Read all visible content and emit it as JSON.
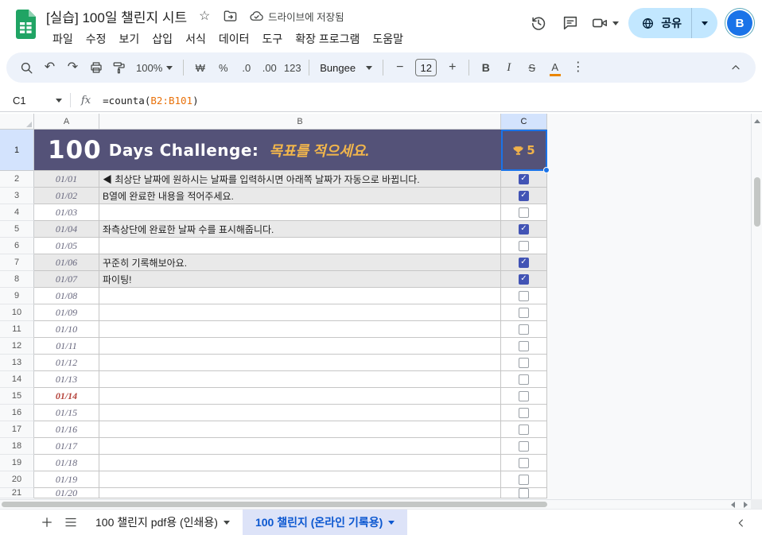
{
  "colors": {
    "banner_bg": "#545278",
    "accent_blue": "#1a73e8",
    "gold": "#f0b24a",
    "checkbox_checked": "#4254b5",
    "share_pill": "#c2e7ff",
    "done_row_bg": "#e9e9e9",
    "today_red": "#b5433b",
    "formula_range_orange": "#e8710a",
    "text_color_swatch": "#ea8600",
    "active_tab_bg": "#dde3f8",
    "active_tab_text": "#0b57d0",
    "selected_header_bg": "#d3e3fd"
  },
  "icons": {
    "undo_icon": "↶",
    "redo_icon": "↷",
    "more_icon": "⋮",
    "star_icon": "☆",
    "checkmark": "✓",
    "minus": "−",
    "plus": "+"
  },
  "titlebar": {
    "doc_title": "[실습] 100일 챌린지 시트",
    "saved_status": "드라이브에 저장됨",
    "share_label": "공유",
    "avatar_initial": "B"
  },
  "menus": [
    "파일",
    "수정",
    "보기",
    "삽입",
    "서식",
    "데이터",
    "도구",
    "확장 프로그램",
    "도움말"
  ],
  "toolbar": {
    "zoom": "100%",
    "currency": "₩",
    "percent": "%",
    "decimal_decrease": ".0",
    "decimal_increase": ".00",
    "number_format": "123",
    "font_name": "Bungee",
    "font_size": "12",
    "bold": "B",
    "italic": "I",
    "strikethrough": "S",
    "text_color": "A"
  },
  "formula_bar": {
    "cell_ref": "C1",
    "fx": "fx",
    "formula_prefix": "=counta(",
    "formula_range": "B2:B101",
    "formula_suffix": ")"
  },
  "grid": {
    "column_headers": [
      "A",
      "B",
      "C"
    ],
    "row1_number": "1",
    "banner": {
      "number": "100",
      "title": "Days Challenge:",
      "subtitle": "목표를 적으세요.",
      "trophy_icon": "trophy-icon",
      "count": "5"
    },
    "rows": [
      {
        "n": 2,
        "date": "01/01",
        "text": "◀ 최상단 날짜에 원하시는 날짜를 입력하시면 아래쪽 날짜가 자동으로 바뀝니다.",
        "checked": true
      },
      {
        "n": 3,
        "date": "01/02",
        "text": "B열에 완료한 내용을 적어주세요.",
        "checked": true
      },
      {
        "n": 4,
        "date": "01/03",
        "text": "",
        "checked": false
      },
      {
        "n": 5,
        "date": "01/04",
        "text": "좌측상단에 완료한 날짜 수를 표시해줍니다.",
        "checked": true
      },
      {
        "n": 6,
        "date": "01/05",
        "text": "",
        "checked": false
      },
      {
        "n": 7,
        "date": "01/06",
        "text": "꾸준히 기록해보아요.",
        "checked": true
      },
      {
        "n": 8,
        "date": "01/07",
        "text": "파이팅!",
        "checked": true
      },
      {
        "n": 9,
        "date": "01/08",
        "text": "",
        "checked": false
      },
      {
        "n": 10,
        "date": "01/09",
        "text": "",
        "checked": false
      },
      {
        "n": 11,
        "date": "01/10",
        "text": "",
        "checked": false
      },
      {
        "n": 12,
        "date": "01/11",
        "text": "",
        "checked": false
      },
      {
        "n": 13,
        "date": "01/12",
        "text": "",
        "checked": false
      },
      {
        "n": 14,
        "date": "01/13",
        "text": "",
        "checked": false
      },
      {
        "n": 15,
        "date": "01/14",
        "text": "",
        "checked": false,
        "today": true
      },
      {
        "n": 16,
        "date": "01/15",
        "text": "",
        "checked": false
      },
      {
        "n": 17,
        "date": "01/16",
        "text": "",
        "checked": false
      },
      {
        "n": 18,
        "date": "01/17",
        "text": "",
        "checked": false
      },
      {
        "n": 19,
        "date": "01/18",
        "text": "",
        "checked": false
      },
      {
        "n": 20,
        "date": "01/19",
        "text": "",
        "checked": false
      },
      {
        "n": 21,
        "date": "01/20",
        "text": "",
        "checked": false,
        "partial": true
      }
    ]
  },
  "tabs": {
    "sheet1": "100 챌린지 pdf용 (인쇄용)",
    "sheet2": "100 챌린지 (온라인 기록용)"
  }
}
